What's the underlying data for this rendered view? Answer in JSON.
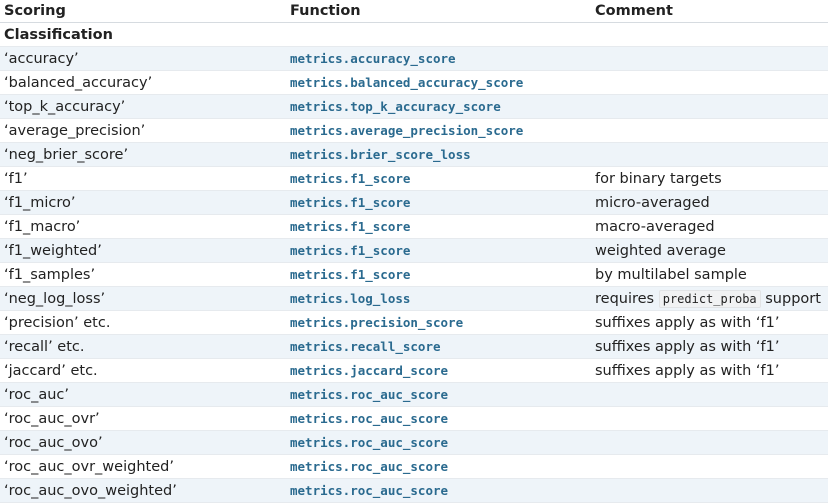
{
  "headers": {
    "scoring": "Scoring",
    "function": "Function",
    "comment": "Comment"
  },
  "section": "Classification",
  "rows": [
    {
      "scoring": "‘accuracy’",
      "function": "metrics.accuracy_score",
      "comment": ""
    },
    {
      "scoring": "‘balanced_accuracy’",
      "function": "metrics.balanced_accuracy_score",
      "comment": ""
    },
    {
      "scoring": "‘top_k_accuracy’",
      "function": "metrics.top_k_accuracy_score",
      "comment": ""
    },
    {
      "scoring": "‘average_precision’",
      "function": "metrics.average_precision_score",
      "comment": ""
    },
    {
      "scoring": "‘neg_brier_score’",
      "function": "metrics.brier_score_loss",
      "comment": ""
    },
    {
      "scoring": "‘f1’",
      "function": "metrics.f1_score",
      "comment": "for binary targets"
    },
    {
      "scoring": "‘f1_micro’",
      "function": "metrics.f1_score",
      "comment": "micro-averaged"
    },
    {
      "scoring": "‘f1_macro’",
      "function": "metrics.f1_score",
      "comment": "macro-averaged"
    },
    {
      "scoring": "‘f1_weighted’",
      "function": "metrics.f1_score",
      "comment": "weighted average"
    },
    {
      "scoring": "‘f1_samples’",
      "function": "metrics.f1_score",
      "comment": "by multilabel sample"
    },
    {
      "scoring": "‘neg_log_loss’",
      "function": "metrics.log_loss",
      "comment_pre": "requires",
      "comment_code": "predict_proba",
      "comment_post": "support"
    },
    {
      "scoring": "‘precision’ etc.",
      "function": "metrics.precision_score",
      "comment": "suffixes apply as with ‘f1’"
    },
    {
      "scoring": "‘recall’ etc.",
      "function": "metrics.recall_score",
      "comment": "suffixes apply as with ‘f1’"
    },
    {
      "scoring": "‘jaccard’ etc.",
      "function": "metrics.jaccard_score",
      "comment": "suffixes apply as with ‘f1’"
    },
    {
      "scoring": "‘roc_auc’",
      "function": "metrics.roc_auc_score",
      "comment": ""
    },
    {
      "scoring": "‘roc_auc_ovr’",
      "function": "metrics.roc_auc_score",
      "comment": ""
    },
    {
      "scoring": "‘roc_auc_ovo’",
      "function": "metrics.roc_auc_score",
      "comment": ""
    },
    {
      "scoring": "‘roc_auc_ovr_weighted’",
      "function": "metrics.roc_auc_score",
      "comment": ""
    },
    {
      "scoring": "‘roc_auc_ovo_weighted’",
      "function": "metrics.roc_auc_score",
      "comment": ""
    }
  ]
}
